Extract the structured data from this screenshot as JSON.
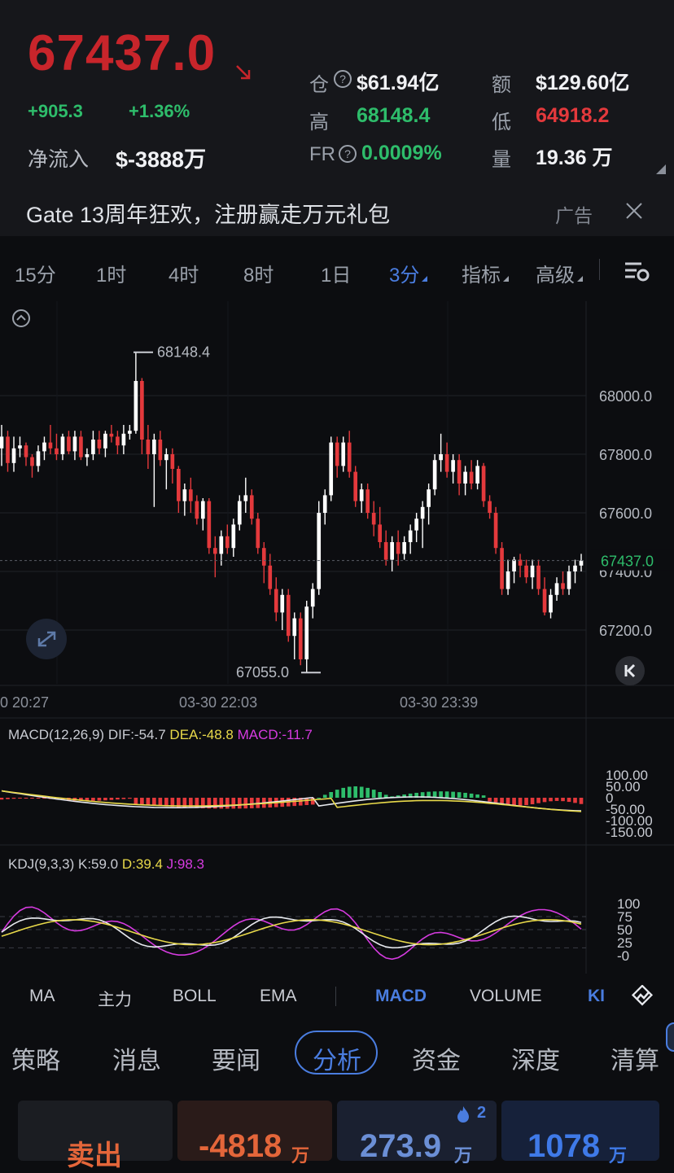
{
  "ticker": {
    "price": "67437.0",
    "change_abs": "+905.3",
    "change_pct": "+1.36%",
    "net_inflow_label": "净流入",
    "net_inflow_value": "$-3888万"
  },
  "stats": {
    "oi_label": "仓",
    "oi_value": "$61.94亿",
    "turnover_label": "额",
    "turnover_value": "$129.60亿",
    "high_label": "高",
    "high_value": "68148.4",
    "low_label": "低",
    "low_value": "64918.2",
    "fr_label": "FR",
    "fr_value": "0.0009%",
    "vol_label": "量",
    "vol_value": "19.36 万"
  },
  "ad": {
    "text": "Gate 13周年狂欢，注册赢走万元礼包",
    "tag": "广告"
  },
  "timeframes": [
    "15分",
    "1时",
    "4时",
    "8时",
    "1日",
    "3分",
    "指标",
    "高级"
  ],
  "active_timeframe": "3分",
  "chart_data": {
    "type": "candlestick",
    "y_ticks": [
      "68000.0",
      "67800.0",
      "67600.0",
      "67400.0",
      "67200.0"
    ],
    "last_price_tag": "67437.0",
    "high_marker": "68148.4",
    "low_marker": "67055.0",
    "x_ticks": [
      "0 20:27",
      "03-30 22:03",
      "03-30 23:39"
    ],
    "candles": [
      [
        67820,
        67900,
        67760,
        67860
      ],
      [
        67860,
        67880,
        67740,
        67770
      ],
      [
        67770,
        67860,
        67740,
        67820
      ],
      [
        67820,
        67860,
        67790,
        67830
      ],
      [
        67830,
        67840,
        67760,
        67790
      ],
      [
        67790,
        67800,
        67720,
        67760
      ],
      [
        67760,
        67830,
        67740,
        67810
      ],
      [
        67810,
        67860,
        67780,
        67840
      ],
      [
        67840,
        67900,
        67800,
        67820
      ],
      [
        67820,
        67870,
        67780,
        67800
      ],
      [
        67800,
        67870,
        67780,
        67860
      ],
      [
        67860,
        67880,
        67800,
        67810
      ],
      [
        67810,
        67880,
        67780,
        67860
      ],
      [
        67860,
        67880,
        67780,
        67790
      ],
      [
        67790,
        67820,
        67760,
        67800
      ],
      [
        67800,
        67880,
        67780,
        67850
      ],
      [
        67850,
        67880,
        67800,
        67820
      ],
      [
        67820,
        67880,
        67790,
        67870
      ],
      [
        67870,
        67900,
        67840,
        67860
      ],
      [
        67860,
        67880,
        67800,
        67830
      ],
      [
        67830,
        67900,
        67800,
        67870
      ],
      [
        67870,
        67900,
        67850,
        67880
      ],
      [
        67880,
        68148,
        67870,
        68050
      ],
      [
        68050,
        68060,
        67800,
        67850
      ],
      [
        67850,
        67900,
        67750,
        67800
      ],
      [
        67800,
        67870,
        67620,
        67850
      ],
      [
        67850,
        67880,
        67760,
        67780
      ],
      [
        67780,
        67820,
        67680,
        67800
      ],
      [
        67800,
        67820,
        67700,
        67750
      ],
      [
        67750,
        67760,
        67600,
        67640
      ],
      [
        67640,
        67700,
        67590,
        67680
      ],
      [
        67680,
        67720,
        67600,
        67640
      ],
      [
        67640,
        67660,
        67560,
        67580
      ],
      [
        67580,
        67650,
        67540,
        67640
      ],
      [
        67640,
        67650,
        67460,
        67480
      ],
      [
        67480,
        67520,
        67380,
        67460
      ],
      [
        67460,
        67540,
        67420,
        67520
      ],
      [
        67520,
        67560,
        67460,
        67480
      ],
      [
        67480,
        67580,
        67450,
        67560
      ],
      [
        67560,
        67660,
        67540,
        67640
      ],
      [
        67640,
        67720,
        67600,
        67660
      ],
      [
        67660,
        67680,
        67560,
        67580
      ],
      [
        67580,
        67600,
        67460,
        67480
      ],
      [
        67480,
        67500,
        67360,
        67420
      ],
      [
        67420,
        67460,
        67320,
        67340
      ],
      [
        67340,
        67380,
        67230,
        67260
      ],
      [
        67260,
        67340,
        67200,
        67320
      ],
      [
        67320,
        67340,
        67160,
        67180
      ],
      [
        67180,
        67260,
        67100,
        67240
      ],
      [
        67240,
        67260,
        67080,
        67100
      ],
      [
        67100,
        67300,
        67055,
        67280
      ],
      [
        67280,
        67360,
        67240,
        67340
      ],
      [
        67340,
        67640,
        67320,
        67600
      ],
      [
        67600,
        67680,
        67560,
        67660
      ],
      [
        67660,
        67860,
        67640,
        67840
      ],
      [
        67840,
        67860,
        67720,
        67760
      ],
      [
        67760,
        67860,
        67740,
        67840
      ],
      [
        67840,
        67880,
        67720,
        67740
      ],
      [
        67740,
        67760,
        67620,
        67640
      ],
      [
        67640,
        67700,
        67600,
        67680
      ],
      [
        67680,
        67700,
        67580,
        67600
      ],
      [
        67600,
        67640,
        67520,
        67560
      ],
      [
        67560,
        67620,
        67480,
        67500
      ],
      [
        67500,
        67540,
        67420,
        67440
      ],
      [
        67440,
        67520,
        67400,
        67500
      ],
      [
        67500,
        67540,
        67420,
        67460
      ],
      [
        67460,
        67520,
        67440,
        67500
      ],
      [
        67500,
        67560,
        67460,
        67540
      ],
      [
        67540,
        67600,
        67500,
        67580
      ],
      [
        67580,
        67640,
        67480,
        67620
      ],
      [
        67620,
        67700,
        67560,
        67680
      ],
      [
        67680,
        67800,
        67660,
        67780
      ],
      [
        67780,
        67870,
        67740,
        67800
      ],
      [
        67800,
        67840,
        67720,
        67740
      ],
      [
        67740,
        67800,
        67700,
        67780
      ],
      [
        67780,
        67800,
        67660,
        67700
      ],
      [
        67700,
        67760,
        67660,
        67740
      ],
      [
        67740,
        67780,
        67680,
        67700
      ],
      [
        67700,
        67780,
        67680,
        67760
      ],
      [
        67760,
        67770,
        67620,
        67640
      ],
      [
        67640,
        67660,
        67580,
        67600
      ],
      [
        67600,
        67620,
        67460,
        67480
      ],
      [
        67480,
        67500,
        67320,
        67340
      ],
      [
        67340,
        67440,
        67320,
        67400
      ],
      [
        67400,
        67450,
        67360,
        67440
      ],
      [
        67440,
        67460,
        67380,
        67420
      ],
      [
        67420,
        67440,
        67360,
        67380
      ],
      [
        67380,
        67440,
        67340,
        67420
      ],
      [
        67420,
        67440,
        67320,
        67340
      ],
      [
        67340,
        67380,
        67250,
        67260
      ],
      [
        67260,
        67340,
        67240,
        67320
      ],
      [
        67320,
        67380,
        67300,
        67360
      ],
      [
        67360,
        67400,
        67320,
        67340
      ],
      [
        67340,
        67420,
        67320,
        67400
      ],
      [
        67400,
        67440,
        67360,
        67420
      ],
      [
        67420,
        67460,
        67400,
        67437
      ]
    ],
    "macd": {
      "label": "MACD(12,26,9)",
      "dif": "DIF:-54.7",
      "dea": "DEA:-48.8",
      "macd": "MACD:-11.7",
      "ticks": [
        "100.00",
        "50.00",
        "0",
        "-50.00",
        "-100.00",
        "-150.00"
      ]
    },
    "kdj": {
      "label": "KDJ(9,3,3)",
      "k": "K:59.0",
      "d": "D:39.4",
      "j": "J:98.3",
      "ticks": [
        "100",
        "75",
        "50",
        "25",
        "-0"
      ]
    }
  },
  "indicator_tabs": [
    "MA",
    "主力",
    "BOLL",
    "EMA",
    "MACD",
    "VOLUME",
    "KI"
  ],
  "sections": [
    "策略",
    "消息",
    "要闻",
    "分析",
    "资金",
    "深度",
    "清算"
  ],
  "cards": {
    "sell_label": "卖出",
    "sell_value": "-4818",
    "sell_unit": "万",
    "c3_value": "273.9",
    "c3_unit": "万",
    "c3_badge": "2",
    "c4_value": "1078",
    "c4_unit": "万"
  },
  "colors": {
    "up": "#e4393c",
    "down": "#ffffff",
    "green": "#2ebd6b",
    "accent": "#4a7de0",
    "dea": "#e8d94a",
    "j": "#d63be0"
  }
}
